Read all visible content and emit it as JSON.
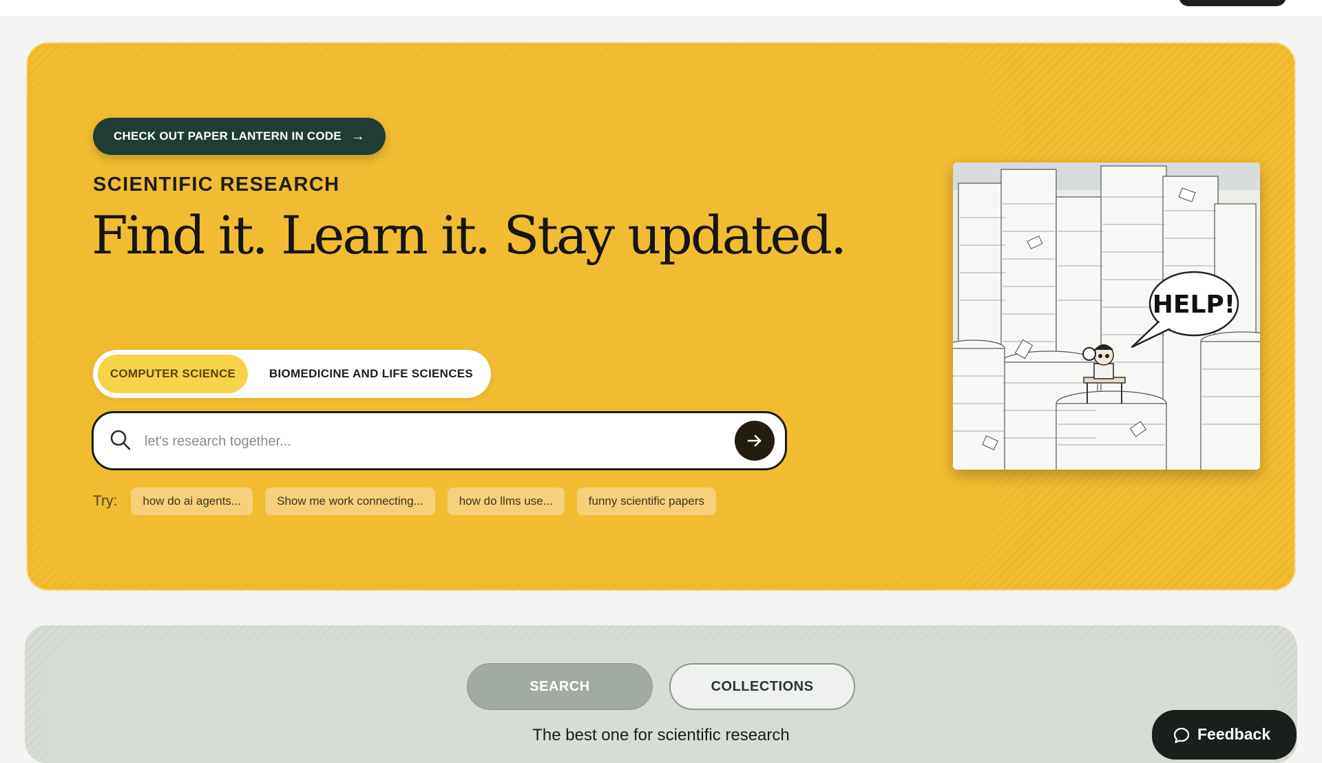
{
  "hero": {
    "cta_label": "CHECK OUT PAPER LANTERN IN CODE",
    "eyebrow": "SCIENTIFIC RESEARCH",
    "headline": "Find it. Learn it. Stay updated.",
    "topics": [
      {
        "label": "COMPUTER SCIENCE",
        "active": true
      },
      {
        "label": "BIOMEDICINE AND LIFE SCIENCES",
        "active": false
      }
    ],
    "search": {
      "placeholder": "let's research together...",
      "value": ""
    },
    "try_label": "Try:",
    "suggestions": [
      "how do ai agents...",
      "Show me work connecting...",
      "how do llms use...",
      "funny scientific papers"
    ],
    "illustration": {
      "icon": "cartoon-paper-stacks-illustration",
      "speech_text": "HELP!"
    }
  },
  "lower": {
    "tabs": [
      {
        "label": "SEARCH",
        "active": true
      },
      {
        "label": "COLLECTIONS",
        "active": false
      }
    ],
    "tagline": "The best one for scientific research"
  },
  "feedback": {
    "label": "Feedback",
    "icon": "chat-bubble-icon"
  },
  "colors": {
    "hero_bg": "#f1bc31",
    "cta_bg": "#1f3d35",
    "active_topic": "#f7d34a",
    "chip_bg": "#f6d07a",
    "lower_bg": "#d7dcd5"
  }
}
